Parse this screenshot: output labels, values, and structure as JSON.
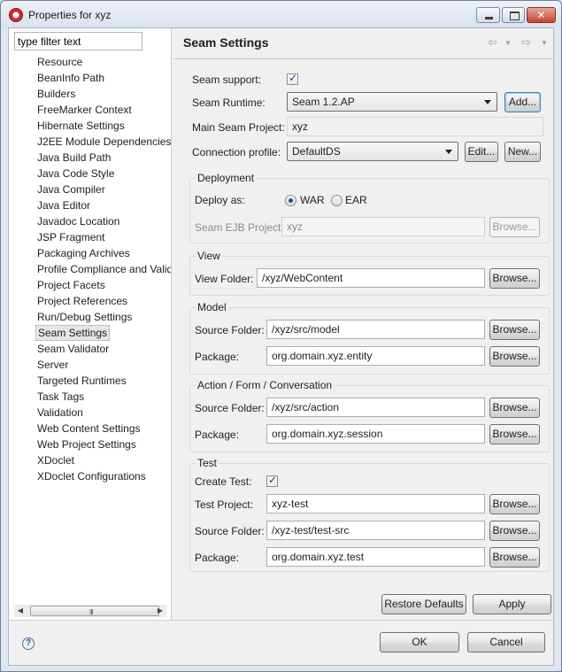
{
  "window": {
    "title": "Properties for xyz"
  },
  "filter": {
    "value": "type filter text"
  },
  "tree": {
    "items": [
      "Resource",
      "BeanInfo Path",
      "Builders",
      "FreeMarker Context",
      "Hibernate Settings",
      "J2EE Module Dependencies",
      "Java Build Path",
      "Java Code Style",
      "Java Compiler",
      "Java Editor",
      "Javadoc Location",
      "JSP Fragment",
      "Packaging Archives",
      "Profile Compliance and Validation",
      "Project Facets",
      "Project References",
      "Run/Debug Settings",
      "Seam Settings",
      "Seam Validator",
      "Server",
      "Targeted Runtimes",
      "Task Tags",
      "Validation",
      "Web Content Settings",
      "Web Project Settings",
      "XDoclet",
      "XDoclet Configurations"
    ],
    "selected": "Seam Settings",
    "scroll_grip": "III"
  },
  "page": {
    "title": "Seam Settings"
  },
  "seam": {
    "support_label": "Seam support:",
    "runtime_label": "Seam Runtime:",
    "runtime_value": "Seam 1.2.AP",
    "add_label": "Add...",
    "main_project_label": "Main Seam Project:",
    "main_project_value": "xyz",
    "connection_label": "Connection profile:",
    "connection_value": "DefaultDS",
    "edit_label": "Edit...",
    "new_label": "New..."
  },
  "deployment": {
    "title": "Deployment",
    "deploy_as_label": "Deploy as:",
    "war_label": "WAR",
    "ear_label": "EAR",
    "ejb_label": "Seam EJB Project:",
    "ejb_value": "xyz",
    "browse_label": "Browse..."
  },
  "view": {
    "title": "View",
    "folder_label": "View Folder:",
    "folder_value": "/xyz/WebContent",
    "browse_label": "Browse..."
  },
  "model": {
    "title": "Model",
    "source_label": "Source Folder:",
    "source_value": "/xyz/src/model",
    "package_label": "Package:",
    "package_value": "org.domain.xyz.entity",
    "browse_label": "Browse..."
  },
  "action": {
    "title": "Action / Form / Conversation",
    "source_label": "Source Folder:",
    "source_value": "/xyz/src/action",
    "package_label": "Package:",
    "package_value": "org.domain.xyz.session",
    "browse_label": "Browse..."
  },
  "test": {
    "title": "Test",
    "create_label": "Create Test:",
    "project_label": "Test Project:",
    "project_value": "xyz-test",
    "source_label": "Source Folder:",
    "source_value": "/xyz-test/test-src",
    "package_label": "Package:",
    "package_value": "org.domain.xyz.test",
    "browse_label": "Browse..."
  },
  "buttons": {
    "restore": "Restore Defaults",
    "apply": "Apply",
    "ok": "OK",
    "cancel": "Cancel",
    "help": "?"
  }
}
